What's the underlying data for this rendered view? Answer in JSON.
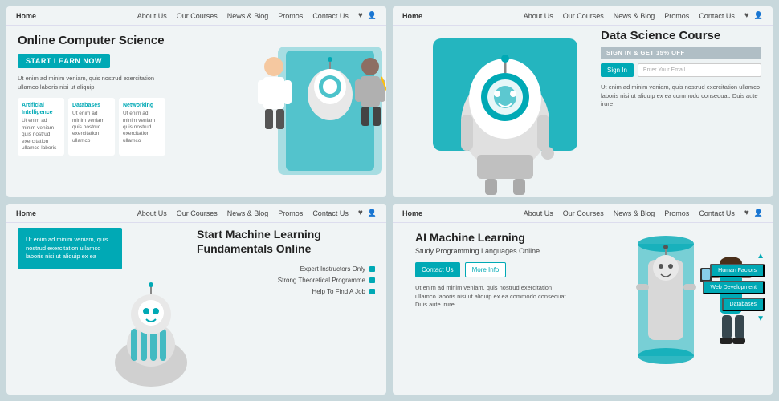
{
  "panels": [
    {
      "id": "panel-1",
      "nav": {
        "home": "Home",
        "links": [
          "About Us",
          "Our Courses",
          "News & Blog",
          "Promos",
          "Contact Us"
        ]
      },
      "heading": "Online Computer Science",
      "cta": "START LEARN NOW",
      "description": "Ut enim ad minim veniam, quis nostrud exercitation ullamco laboris nisi ut aliquip",
      "cards": [
        {
          "title": "Artificial Intelligence",
          "text": "Ut enim ad minim veniam quis nostrud exercitation ullamco laboris"
        },
        {
          "title": "Databases",
          "text": "Ut enim ad minim veniam quis nostrud exercitation ullamco"
        },
        {
          "title": "Networking",
          "text": "Ut enim ad minim veniam quis nostrud exercitation ullamco"
        }
      ]
    },
    {
      "id": "panel-2",
      "nav": {
        "home": "Home",
        "links": [
          "About Us",
          "Our Courses",
          "News & Blog",
          "Promos",
          "Contact Us"
        ]
      },
      "heading": "Data Science Course",
      "promo": "SIGN IN & GET 15% OFF",
      "signin": "Sign In",
      "email_placeholder": "Enter Your Email",
      "description": "Ut enim ad minim veniam, quis nostrud exercitation ullamco laboris nisi ut aliquip ex ea commodo consequat. Duis aute irure"
    },
    {
      "id": "panel-3",
      "nav": {
        "home": "Home",
        "links": [
          "About Us",
          "Our Courses",
          "News & Blog",
          "Promos",
          "Contact Us"
        ]
      },
      "heading": "Start Machine Learning Fundamentals Online",
      "features": [
        "Expert Instructors Only",
        "Strong Theoretical Programme",
        "Help To Find A Job"
      ],
      "left_text": "Ut enim ad minim veniam, quis nostrud exercitation ullamco laboris nisi ut aliquip ex ea"
    },
    {
      "id": "panel-4",
      "nav": {
        "home": "Home",
        "links": [
          "About Us",
          "Our Courses",
          "News & Blog",
          "Promos",
          "Contact Us"
        ]
      },
      "heading": "AI Machine Learning",
      "subheading": "Study Programming Languages Online",
      "btn_contact": "Contact Us",
      "btn_more": "More Info",
      "description": "Ut enim ad minim veniam, quis nostrud exercitation ullamco laboris nisi ut aliquip ex ea commodo consequat. Duis aute irure",
      "tags": [
        "Human Factors",
        "Web Development",
        "Databases"
      ]
    }
  ],
  "colors": {
    "teal": "#00a9b5",
    "light_bg": "#f0f4f5",
    "dark_text": "#222",
    "mid_text": "#555"
  }
}
